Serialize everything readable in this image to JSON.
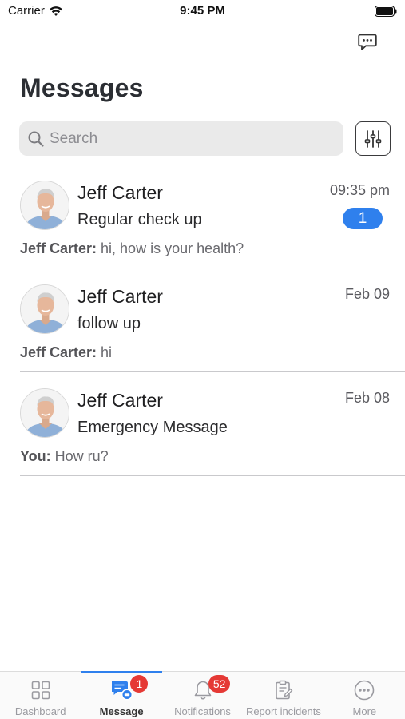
{
  "status_bar": {
    "carrier": "Carrier",
    "time": "9:45 PM"
  },
  "header": {
    "title": "Messages"
  },
  "search": {
    "placeholder": "Search",
    "value": ""
  },
  "conversations": [
    {
      "name": "Jeff Carter",
      "subject": "Regular check up",
      "time": "09:35 pm",
      "unread": "1",
      "preview_sender": "Jeff Carter:",
      "preview_text": " hi, how is your health?"
    },
    {
      "name": "Jeff Carter",
      "subject": "follow up",
      "time": "Feb 09",
      "preview_sender": "Jeff Carter:",
      "preview_text": " hi"
    },
    {
      "name": "Jeff Carter",
      "subject": "Emergency Message",
      "time": "Feb 08",
      "preview_sender": "You:",
      "preview_text": " How ru?"
    }
  ],
  "tabs": [
    {
      "label": "Dashboard",
      "icon": "grid-icon"
    },
    {
      "label": "Message",
      "icon": "message-icon",
      "badge": "1",
      "active": true
    },
    {
      "label": "Notifications",
      "icon": "bell-icon",
      "badge": "52"
    },
    {
      "label": "Report incidents",
      "icon": "clipboard-icon"
    },
    {
      "label": "More",
      "icon": "more-icon"
    }
  ],
  "colors": {
    "accent": "#2f80ed",
    "badge": "#e53935",
    "title": "#2b2e33"
  }
}
